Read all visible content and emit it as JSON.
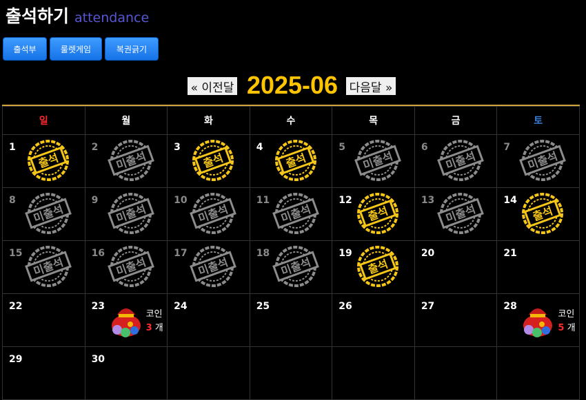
{
  "header": {
    "title": "출석하기",
    "subtitle": "attendance"
  },
  "tabs": [
    {
      "label": "출석부",
      "name": "tab-attendance"
    },
    {
      "label": "룰렛게임",
      "name": "tab-roulette"
    },
    {
      "label": "복권긁기",
      "name": "tab-lottery"
    }
  ],
  "nav": {
    "prev_label": "« 이전달",
    "month": "2025-06",
    "next_label": "다음달 »"
  },
  "weekdays": [
    "일",
    "월",
    "화",
    "수",
    "목",
    "금",
    "토"
  ],
  "colors": {
    "attended": "#f5c518",
    "missed": "#8c8c8c",
    "accent": "#ffc400"
  },
  "stamps": {
    "attended_text": "출석",
    "missed_text": "미출석"
  },
  "weeks": [
    [
      {
        "day": "1",
        "status": "attended"
      },
      {
        "day": "2",
        "status": "missed"
      },
      {
        "day": "3",
        "status": "attended"
      },
      {
        "day": "4",
        "status": "attended"
      },
      {
        "day": "5",
        "status": "missed"
      },
      {
        "day": "6",
        "status": "missed"
      },
      {
        "day": "7",
        "status": "missed"
      }
    ],
    [
      {
        "day": "8",
        "status": "missed"
      },
      {
        "day": "9",
        "status": "missed"
      },
      {
        "day": "10",
        "status": "missed"
      },
      {
        "day": "11",
        "status": "missed"
      },
      {
        "day": "12",
        "status": "attended"
      },
      {
        "day": "13",
        "status": "missed"
      },
      {
        "day": "14",
        "status": "attended"
      }
    ],
    [
      {
        "day": "15",
        "status": "missed"
      },
      {
        "day": "16",
        "status": "missed"
      },
      {
        "day": "17",
        "status": "missed"
      },
      {
        "day": "18",
        "status": "missed"
      },
      {
        "day": "19",
        "status": "attended"
      },
      {
        "day": "20",
        "status": "none"
      },
      {
        "day": "21",
        "status": "none"
      }
    ],
    [
      {
        "day": "22",
        "status": "none"
      },
      {
        "day": "23",
        "status": "none",
        "reward": {
          "label": "코인",
          "count": "3",
          "unit": "개"
        }
      },
      {
        "day": "24",
        "status": "none"
      },
      {
        "day": "25",
        "status": "none"
      },
      {
        "day": "26",
        "status": "none"
      },
      {
        "day": "27",
        "status": "none"
      },
      {
        "day": "28",
        "status": "none",
        "reward": {
          "label": "코인",
          "count": "5",
          "unit": "개"
        }
      }
    ],
    [
      {
        "day": "29",
        "status": "none"
      },
      {
        "day": "30",
        "status": "none"
      },
      {
        "day": "",
        "status": "empty"
      },
      {
        "day": "",
        "status": "empty"
      },
      {
        "day": "",
        "status": "empty"
      },
      {
        "day": "",
        "status": "empty"
      },
      {
        "day": "",
        "status": "empty"
      }
    ]
  ]
}
